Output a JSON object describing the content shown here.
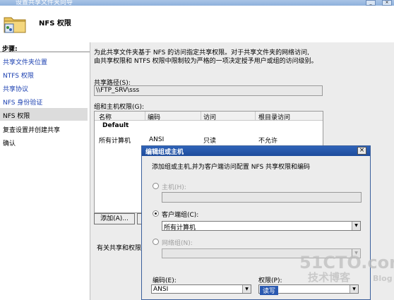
{
  "window": {
    "title": "设置共享文件夹向导"
  },
  "header": {
    "title": "NFS 权限"
  },
  "steps": {
    "label": "步骤:",
    "items": [
      "共享文件夹位置",
      "NTFS 权限",
      "共享协议",
      "NFS 身份验证",
      "NFS 权限",
      "复查设置并创建共享",
      "确认"
    ]
  },
  "main": {
    "description_line1": "为此共享文件夹基于 NFS 的访问指定共享权限。对于共享文件夹的网络访问,",
    "description_line2": "由共享权限和 NTFS 权限中限制较为严格的一项决定授予用户或组的访问级别。",
    "share_path_label": "共享路径(S):",
    "share_path_value": "\\\\FTP_SRV\\sss",
    "groups_label": "组和主机权限(G):",
    "columns": [
      "名称",
      "编码",
      "访问",
      "根目录访问"
    ],
    "default_row": "Default",
    "rows": [
      {
        "name": "所有计算机",
        "encoding": "ANSI",
        "access": "只读",
        "root": "不允许"
      }
    ],
    "add_button": "添加(A)...",
    "footer_text": "有关共享和权限"
  },
  "dialog": {
    "title": "编辑组或主机",
    "description": "添加组或主机,并为客户端访问配置 NFS 共享权限和编码",
    "host_label": "主机(H):",
    "client_group_label": "客户端组(C):",
    "client_group_value": "所有计算机",
    "netgroup_label": "网络组(N):",
    "encoding_label": "编码(E):",
    "encoding_value": "ANSI",
    "permission_label": "权限(P):",
    "permission_value": "读写"
  },
  "watermark": {
    "line1": "51CTO.com",
    "line2": "技术博客",
    "line3": "Blog"
  }
}
